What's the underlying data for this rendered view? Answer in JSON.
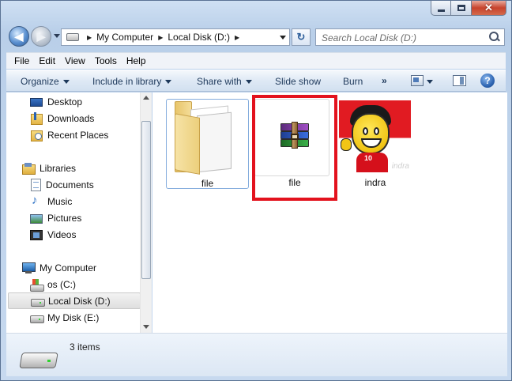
{
  "window": {
    "close_glyph": "✕"
  },
  "navigation": {
    "back_glyph": "◀",
    "forward_glyph": "▶",
    "address_parts": [
      "My Computer",
      "Local Disk (D:)"
    ],
    "separator": "▶",
    "refresh_glyph": "↻",
    "search_placeholder": "Search Local Disk (D:)"
  },
  "menubar": {
    "items": [
      "File",
      "Edit",
      "View",
      "Tools",
      "Help"
    ]
  },
  "commandbar": {
    "organize": "Organize",
    "include_in_library": "Include in library",
    "share_with": "Share with",
    "slide_show": "Slide show",
    "burn": "Burn",
    "more": "»",
    "help": "?"
  },
  "sidebar": {
    "favorites": [
      {
        "label": "Desktop",
        "icon": "desktop-icon"
      },
      {
        "label": "Downloads",
        "icon": "downloads-icon"
      },
      {
        "label": "Recent Places",
        "icon": "recent-places-icon"
      }
    ],
    "libraries_header": {
      "label": "Libraries",
      "icon": "libraries-icon"
    },
    "libraries": [
      {
        "label": "Documents",
        "icon": "documents-icon"
      },
      {
        "label": "Music",
        "icon": "music-icon"
      },
      {
        "label": "Pictures",
        "icon": "pictures-icon"
      },
      {
        "label": "Videos",
        "icon": "videos-icon"
      }
    ],
    "computer_header": {
      "label": "My Computer",
      "icon": "computer-icon"
    },
    "drives": [
      {
        "label": "os (C:)",
        "icon": "os-drive-icon",
        "selected": false
      },
      {
        "label": "Local Disk (D:)",
        "icon": "drive-icon",
        "selected": true
      },
      {
        "label": "My Disk (E:)",
        "icon": "drive-icon",
        "selected": false
      }
    ]
  },
  "files": [
    {
      "name": "file",
      "type": "folder",
      "icon": "folder-icon"
    },
    {
      "name": "file",
      "type": "rar-archive",
      "icon": "winrar-archive-icon",
      "highlighted": true
    },
    {
      "name": "indra",
      "type": "image",
      "icon": "image-thumbnail",
      "thumb_number": "10",
      "thumb_watermark": "indra"
    }
  ],
  "status": {
    "items_count": "3 items"
  },
  "colors": {
    "highlight_box": "#e3121d",
    "selection_border": "#84acdd"
  }
}
